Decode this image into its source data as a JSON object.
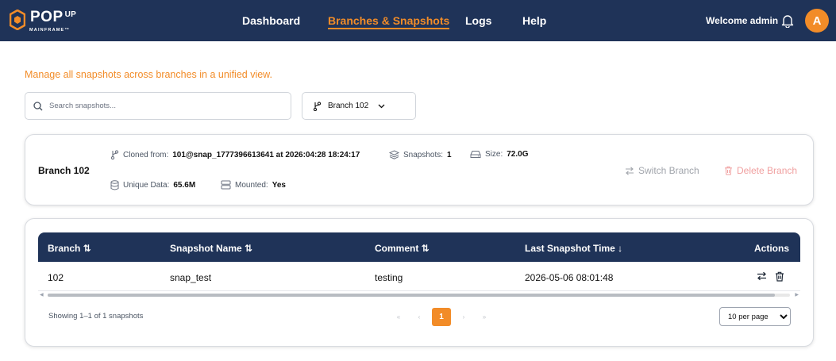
{
  "brand": {
    "name": "POP",
    "sup": "UP",
    "sub": "MAINFRAME™",
    "accent": "#f28c28",
    "navy": "#1f3358"
  },
  "nav": {
    "items": [
      {
        "label": "Dashboard"
      },
      {
        "label": "Branches & Snapshots",
        "active": true
      },
      {
        "label": "Logs"
      },
      {
        "label": "Help"
      }
    ],
    "welcome": "Welcome admin",
    "avatar": "A"
  },
  "page": {
    "intro": "Manage all snapshots across branches in a unified view.",
    "search_placeholder": "Search snapshots...",
    "branch_selector": "Branch 102"
  },
  "branch_info": {
    "title": "Branch 102",
    "cloned_from_label": "Cloned from:",
    "cloned_from": "101@snap_1777396613641 at 2026:04:28 18:24:17",
    "snapshots_label": "Snapshots:",
    "snapshots": "1",
    "size_label": "Size:",
    "size": "72.0G",
    "unique_label": "Unique Data:",
    "unique": "65.6M",
    "mounted_label": "Mounted:",
    "mounted": "Yes",
    "switch_label": "Switch Branch",
    "delete_label": "Delete Branch"
  },
  "table": {
    "columns": [
      "Branch ⇅",
      "Snapshot Name ⇅",
      "Comment ⇅",
      "Last Snapshot Time ↓",
      "Actions"
    ],
    "rows": [
      {
        "branch": "102",
        "name": "snap_test",
        "comment": "testing",
        "time": "2026-05-06 08:01:48"
      }
    ],
    "showing": "Showing 1–1 of 1 snapshots",
    "pager": {
      "first": "«",
      "prev": "‹",
      "current": "1",
      "next": "›",
      "last": "»"
    },
    "per_page_options": [
      "10 per page"
    ]
  }
}
